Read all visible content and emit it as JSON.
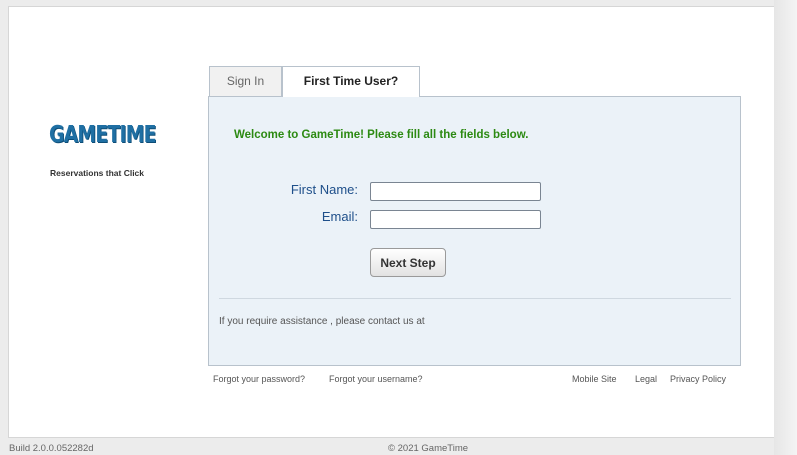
{
  "brand": {
    "logo_text": "GAMETIME",
    "tagline": "Reservations that Click"
  },
  "tabs": [
    {
      "label": "Sign In",
      "active": false
    },
    {
      "label": "First Time User?",
      "active": true
    }
  ],
  "form": {
    "welcome": "Welcome to GameTime! Please fill all the fields below.",
    "first_name_label": "First Name:",
    "first_name_value": "",
    "email_label": "Email:",
    "email_value": "",
    "submit_label": "Next Step"
  },
  "assistance_text": "If you require assistance , please contact us at",
  "links": {
    "forgot_password": "Forgot your password?",
    "forgot_username": "Forgot your username?",
    "mobile_site": "Mobile Site",
    "legal": "Legal",
    "privacy_policy": "Privacy Policy"
  },
  "footer": {
    "build": "Build 2.0.0.052282d",
    "copyright": "© 2021 GameTime"
  },
  "colors": {
    "logo": "#1f6fa3",
    "welcome": "#2c8a12",
    "labels": "#1e4f8a",
    "panel": "#ebf2f8"
  }
}
